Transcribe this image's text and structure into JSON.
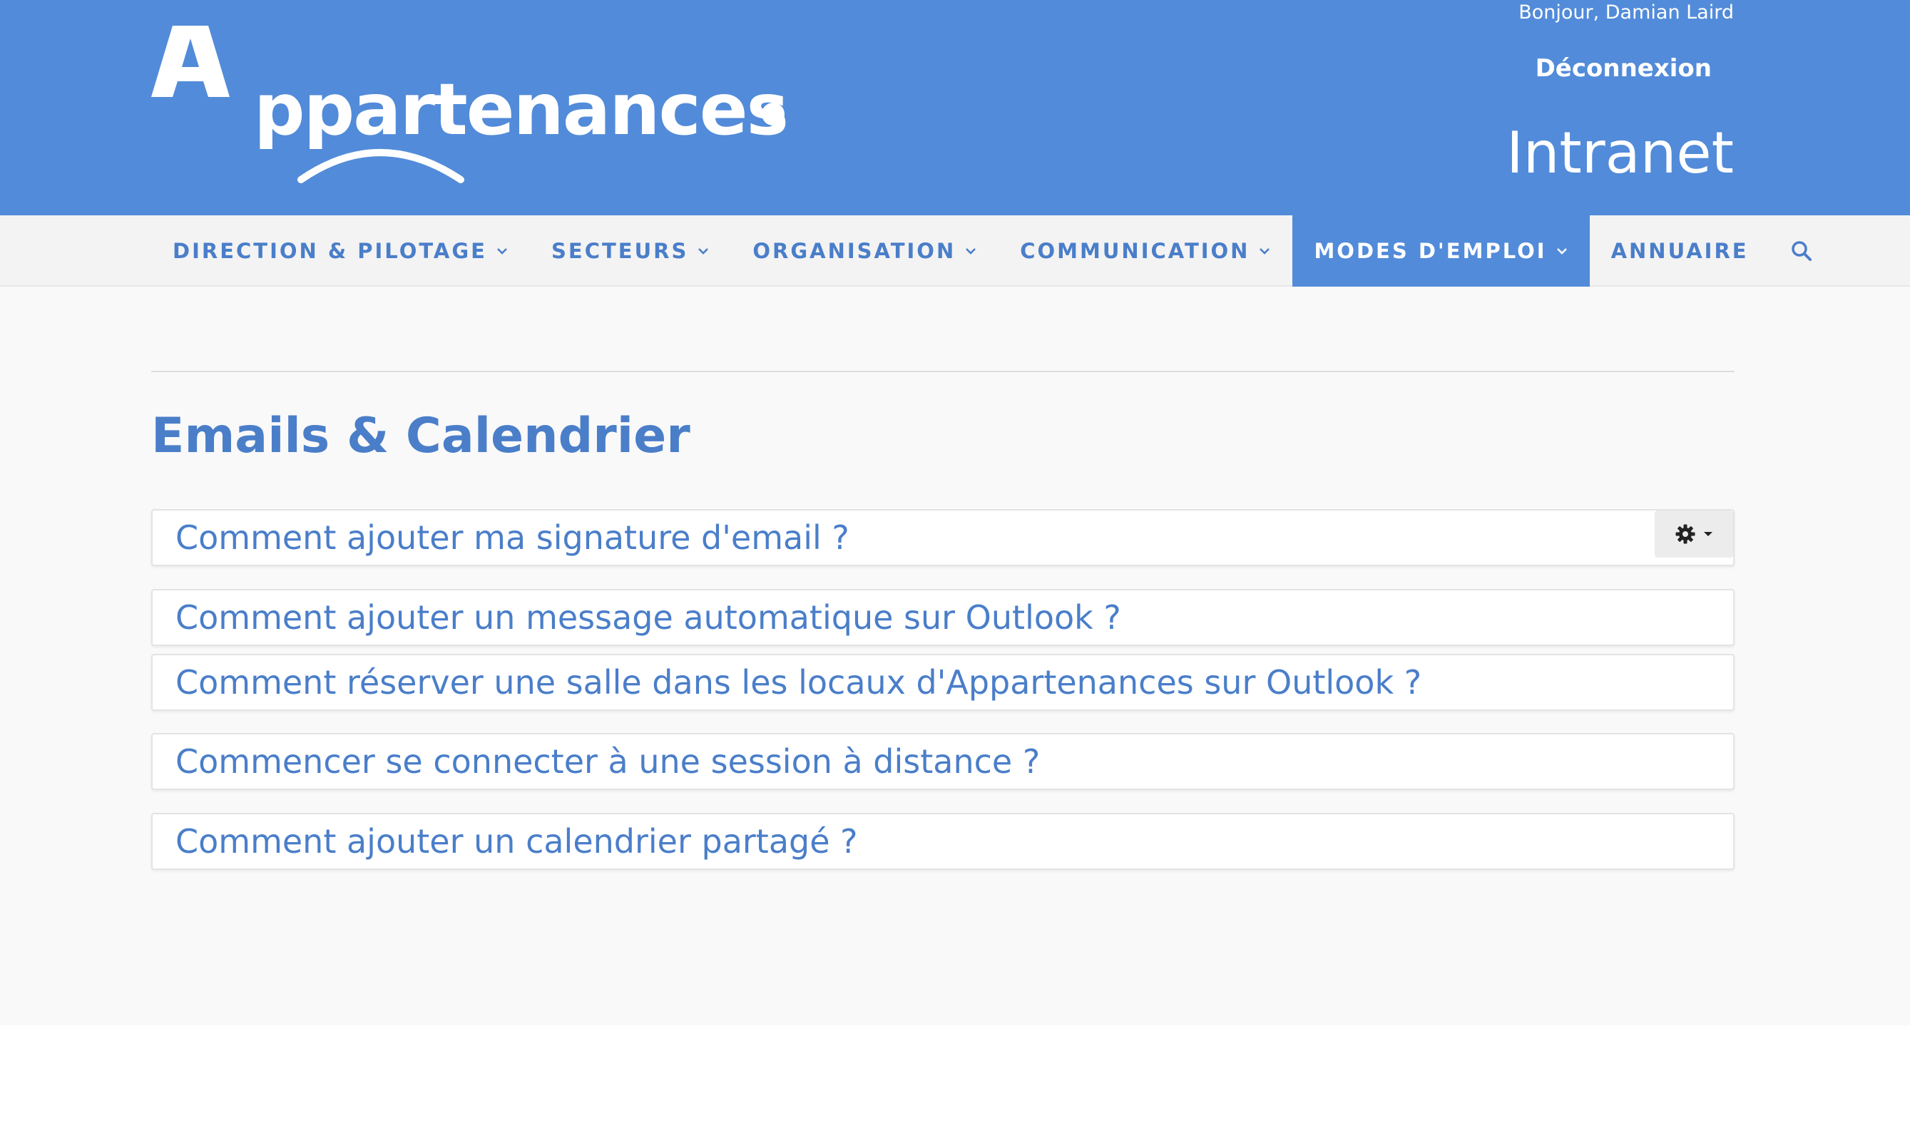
{
  "header": {
    "logo_text": "Appartenances",
    "greeting": "Bonjour, Damian Laird",
    "logout_label": "Déconnexion",
    "site_label": "Intranet",
    "brand_color": "#528bd9"
  },
  "nav": {
    "items": [
      {
        "label": "DIRECTION & PILOTAGE",
        "dropdown": true
      },
      {
        "label": "SECTEURS",
        "dropdown": true
      },
      {
        "label": "ORGANISATION",
        "dropdown": true
      },
      {
        "label": "COMMUNICATION",
        "dropdown": true
      },
      {
        "label": "MODES D'EMPLOI",
        "dropdown": true,
        "active": true
      },
      {
        "label": "ANNUAIRE",
        "dropdown": false
      }
    ],
    "search_icon": "search-icon"
  },
  "main": {
    "title": "Emails & Calendrier",
    "items": [
      {
        "label": "Comment ajouter ma signature d'email ?"
      },
      {
        "label": "Comment ajouter un message automatique sur Outlook ?"
      },
      {
        "label": "Comment réserver une salle dans les locaux d'Appartenances sur Outlook ?"
      },
      {
        "label": "Commencer se connecter à une session à distance ?"
      },
      {
        "label": "Comment ajouter un calendrier partagé ?"
      }
    ],
    "settings_icon": "gear-icon"
  }
}
